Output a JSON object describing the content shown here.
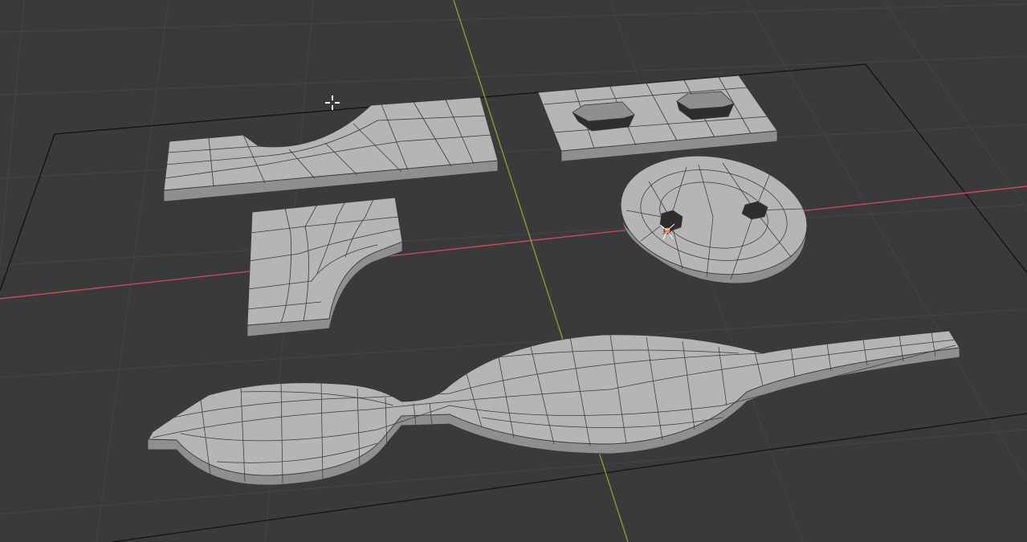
{
  "viewport": {
    "background": "#3a3a3a",
    "grid_color": "#454545",
    "floor_outline_color": "#121212",
    "x_axis_color": "#c8495a",
    "y_axis_color": "#8c9a2e",
    "mesh_face_color": "#b5b5b5",
    "mesh_side_color": "#8f8f8f",
    "mesh_edge_color": "#3a3a3a"
  },
  "objects": [
    {
      "name": "slab-with-arc-cutout"
    },
    {
      "name": "plate-with-two-octagon-holes"
    },
    {
      "name": "l-bend-panel"
    },
    {
      "name": "disc-with-two-holes"
    },
    {
      "name": "bulb-bar"
    }
  ],
  "cursor_icon": "crosshair-cursor-icon",
  "origin_icon": "object-origin-icon"
}
